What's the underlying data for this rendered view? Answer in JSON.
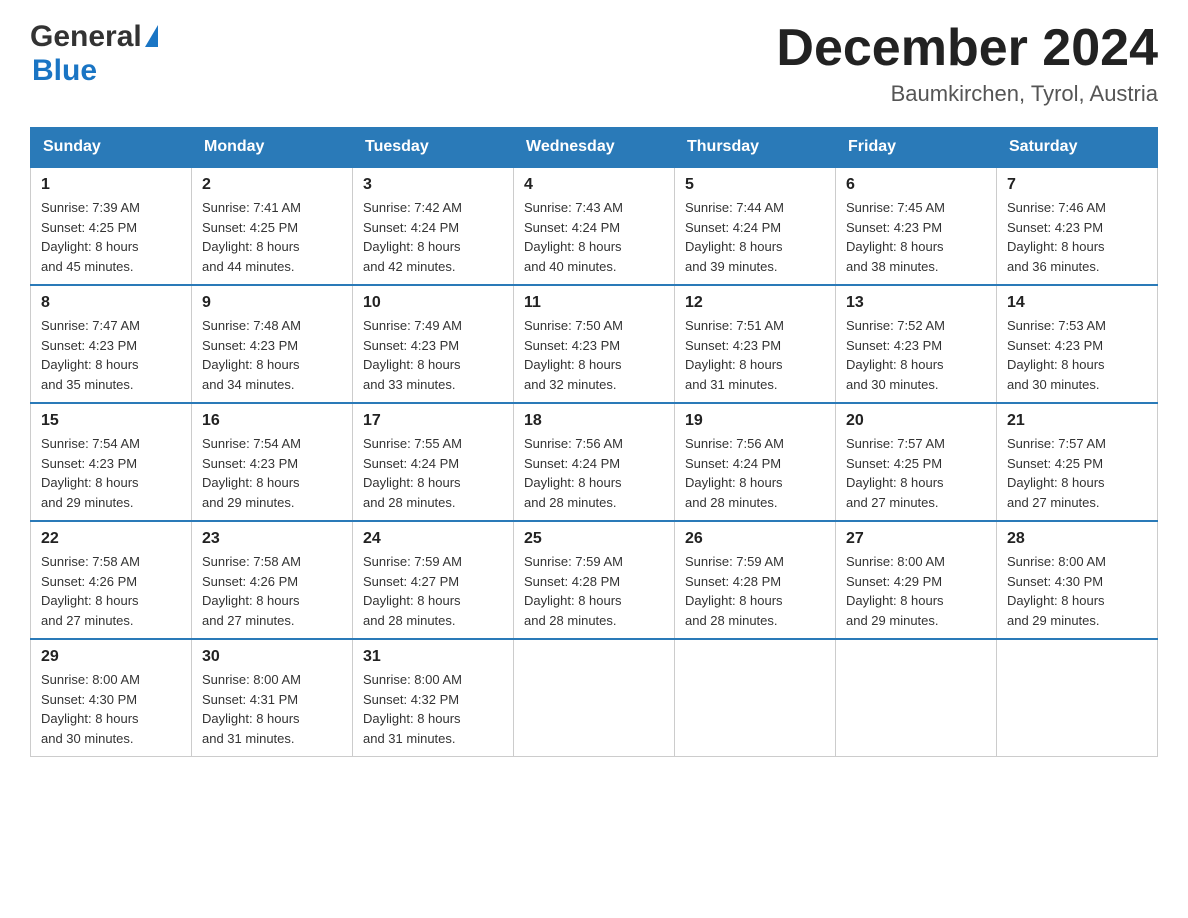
{
  "logo": {
    "general": "General",
    "triangle": "▶",
    "blue": "Blue"
  },
  "title": "December 2024",
  "subtitle": "Baumkirchen, Tyrol, Austria",
  "days_of_week": [
    "Sunday",
    "Monday",
    "Tuesday",
    "Wednesday",
    "Thursday",
    "Friday",
    "Saturday"
  ],
  "weeks": [
    [
      {
        "day": "1",
        "info": "Sunrise: 7:39 AM\nSunset: 4:25 PM\nDaylight: 8 hours\nand 45 minutes."
      },
      {
        "day": "2",
        "info": "Sunrise: 7:41 AM\nSunset: 4:25 PM\nDaylight: 8 hours\nand 44 minutes."
      },
      {
        "day": "3",
        "info": "Sunrise: 7:42 AM\nSunset: 4:24 PM\nDaylight: 8 hours\nand 42 minutes."
      },
      {
        "day": "4",
        "info": "Sunrise: 7:43 AM\nSunset: 4:24 PM\nDaylight: 8 hours\nand 40 minutes."
      },
      {
        "day": "5",
        "info": "Sunrise: 7:44 AM\nSunset: 4:24 PM\nDaylight: 8 hours\nand 39 minutes."
      },
      {
        "day": "6",
        "info": "Sunrise: 7:45 AM\nSunset: 4:23 PM\nDaylight: 8 hours\nand 38 minutes."
      },
      {
        "day": "7",
        "info": "Sunrise: 7:46 AM\nSunset: 4:23 PM\nDaylight: 8 hours\nand 36 minutes."
      }
    ],
    [
      {
        "day": "8",
        "info": "Sunrise: 7:47 AM\nSunset: 4:23 PM\nDaylight: 8 hours\nand 35 minutes."
      },
      {
        "day": "9",
        "info": "Sunrise: 7:48 AM\nSunset: 4:23 PM\nDaylight: 8 hours\nand 34 minutes."
      },
      {
        "day": "10",
        "info": "Sunrise: 7:49 AM\nSunset: 4:23 PM\nDaylight: 8 hours\nand 33 minutes."
      },
      {
        "day": "11",
        "info": "Sunrise: 7:50 AM\nSunset: 4:23 PM\nDaylight: 8 hours\nand 32 minutes."
      },
      {
        "day": "12",
        "info": "Sunrise: 7:51 AM\nSunset: 4:23 PM\nDaylight: 8 hours\nand 31 minutes."
      },
      {
        "day": "13",
        "info": "Sunrise: 7:52 AM\nSunset: 4:23 PM\nDaylight: 8 hours\nand 30 minutes."
      },
      {
        "day": "14",
        "info": "Sunrise: 7:53 AM\nSunset: 4:23 PM\nDaylight: 8 hours\nand 30 minutes."
      }
    ],
    [
      {
        "day": "15",
        "info": "Sunrise: 7:54 AM\nSunset: 4:23 PM\nDaylight: 8 hours\nand 29 minutes."
      },
      {
        "day": "16",
        "info": "Sunrise: 7:54 AM\nSunset: 4:23 PM\nDaylight: 8 hours\nand 29 minutes."
      },
      {
        "day": "17",
        "info": "Sunrise: 7:55 AM\nSunset: 4:24 PM\nDaylight: 8 hours\nand 28 minutes."
      },
      {
        "day": "18",
        "info": "Sunrise: 7:56 AM\nSunset: 4:24 PM\nDaylight: 8 hours\nand 28 minutes."
      },
      {
        "day": "19",
        "info": "Sunrise: 7:56 AM\nSunset: 4:24 PM\nDaylight: 8 hours\nand 28 minutes."
      },
      {
        "day": "20",
        "info": "Sunrise: 7:57 AM\nSunset: 4:25 PM\nDaylight: 8 hours\nand 27 minutes."
      },
      {
        "day": "21",
        "info": "Sunrise: 7:57 AM\nSunset: 4:25 PM\nDaylight: 8 hours\nand 27 minutes."
      }
    ],
    [
      {
        "day": "22",
        "info": "Sunrise: 7:58 AM\nSunset: 4:26 PM\nDaylight: 8 hours\nand 27 minutes."
      },
      {
        "day": "23",
        "info": "Sunrise: 7:58 AM\nSunset: 4:26 PM\nDaylight: 8 hours\nand 27 minutes."
      },
      {
        "day": "24",
        "info": "Sunrise: 7:59 AM\nSunset: 4:27 PM\nDaylight: 8 hours\nand 28 minutes."
      },
      {
        "day": "25",
        "info": "Sunrise: 7:59 AM\nSunset: 4:28 PM\nDaylight: 8 hours\nand 28 minutes."
      },
      {
        "day": "26",
        "info": "Sunrise: 7:59 AM\nSunset: 4:28 PM\nDaylight: 8 hours\nand 28 minutes."
      },
      {
        "day": "27",
        "info": "Sunrise: 8:00 AM\nSunset: 4:29 PM\nDaylight: 8 hours\nand 29 minutes."
      },
      {
        "day": "28",
        "info": "Sunrise: 8:00 AM\nSunset: 4:30 PM\nDaylight: 8 hours\nand 29 minutes."
      }
    ],
    [
      {
        "day": "29",
        "info": "Sunrise: 8:00 AM\nSunset: 4:30 PM\nDaylight: 8 hours\nand 30 minutes."
      },
      {
        "day": "30",
        "info": "Sunrise: 8:00 AM\nSunset: 4:31 PM\nDaylight: 8 hours\nand 31 minutes."
      },
      {
        "day": "31",
        "info": "Sunrise: 8:00 AM\nSunset: 4:32 PM\nDaylight: 8 hours\nand 31 minutes."
      },
      null,
      null,
      null,
      null
    ]
  ]
}
